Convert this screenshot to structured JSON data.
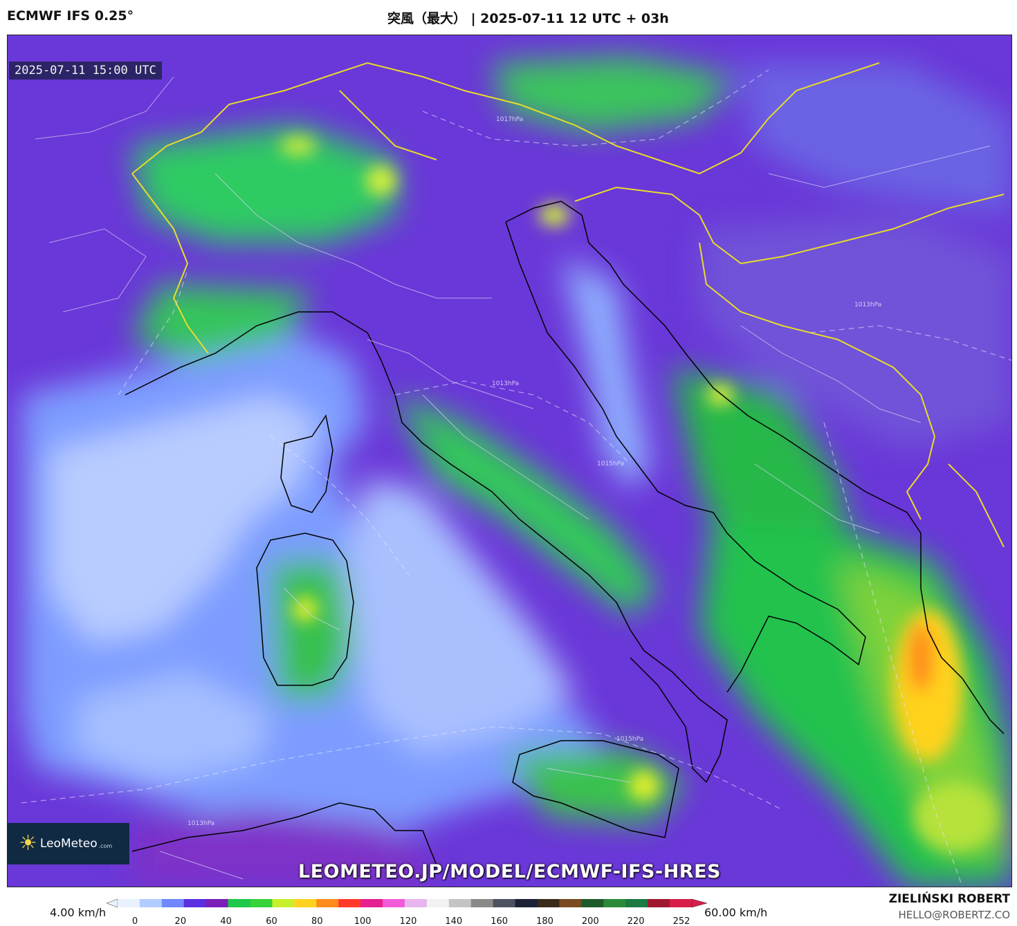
{
  "header": {
    "model": "ECMWF IFS 0.25°",
    "title": "突風（最大） | 2025-07-11 12 UTC + 03h"
  },
  "map": {
    "valid_time": "2025-07-11 15:00 UTC",
    "logo": {
      "brand": "LeoMeteo",
      "domain": ".com"
    },
    "watermark_url": "LEOMETEO.JP/MODEL/ECMWF-IFS-HRES",
    "isobar_labels": [
      "1017hPa",
      "1013hPa",
      "1015hPa",
      "1013hPa",
      "1015hPa",
      "1013hPa"
    ]
  },
  "colorbar": {
    "min_label": "4.00 km/h",
    "max_label": "60.00 km/h",
    "ticks": [
      "0",
      "20",
      "40",
      "60",
      "80",
      "100",
      "120",
      "140",
      "160",
      "180",
      "200",
      "220",
      "252"
    ],
    "colors": [
      "#e8f1ff",
      "#b3ccff",
      "#6f87ff",
      "#5a2fe0",
      "#7a1fb8",
      "#1fc94a",
      "#38d23a",
      "#c7f02a",
      "#ffd21f",
      "#ff8c1a",
      "#ff3a2a",
      "#e52090",
      "#f05cd8",
      "#e8b6ee",
      "#f2f2f2",
      "#c4c4c4",
      "#8a8a8a",
      "#4c5260",
      "#1b2238",
      "#3a2a1a",
      "#7a4a20",
      "#1f5a2a",
      "#2a8a3a",
      "#1a7a40",
      "#a01830",
      "#d81e4a"
    ]
  },
  "credits": {
    "author": "ZIELIŃSKI ROBERT",
    "email": "HELLO@ROBERTZ.CO"
  }
}
